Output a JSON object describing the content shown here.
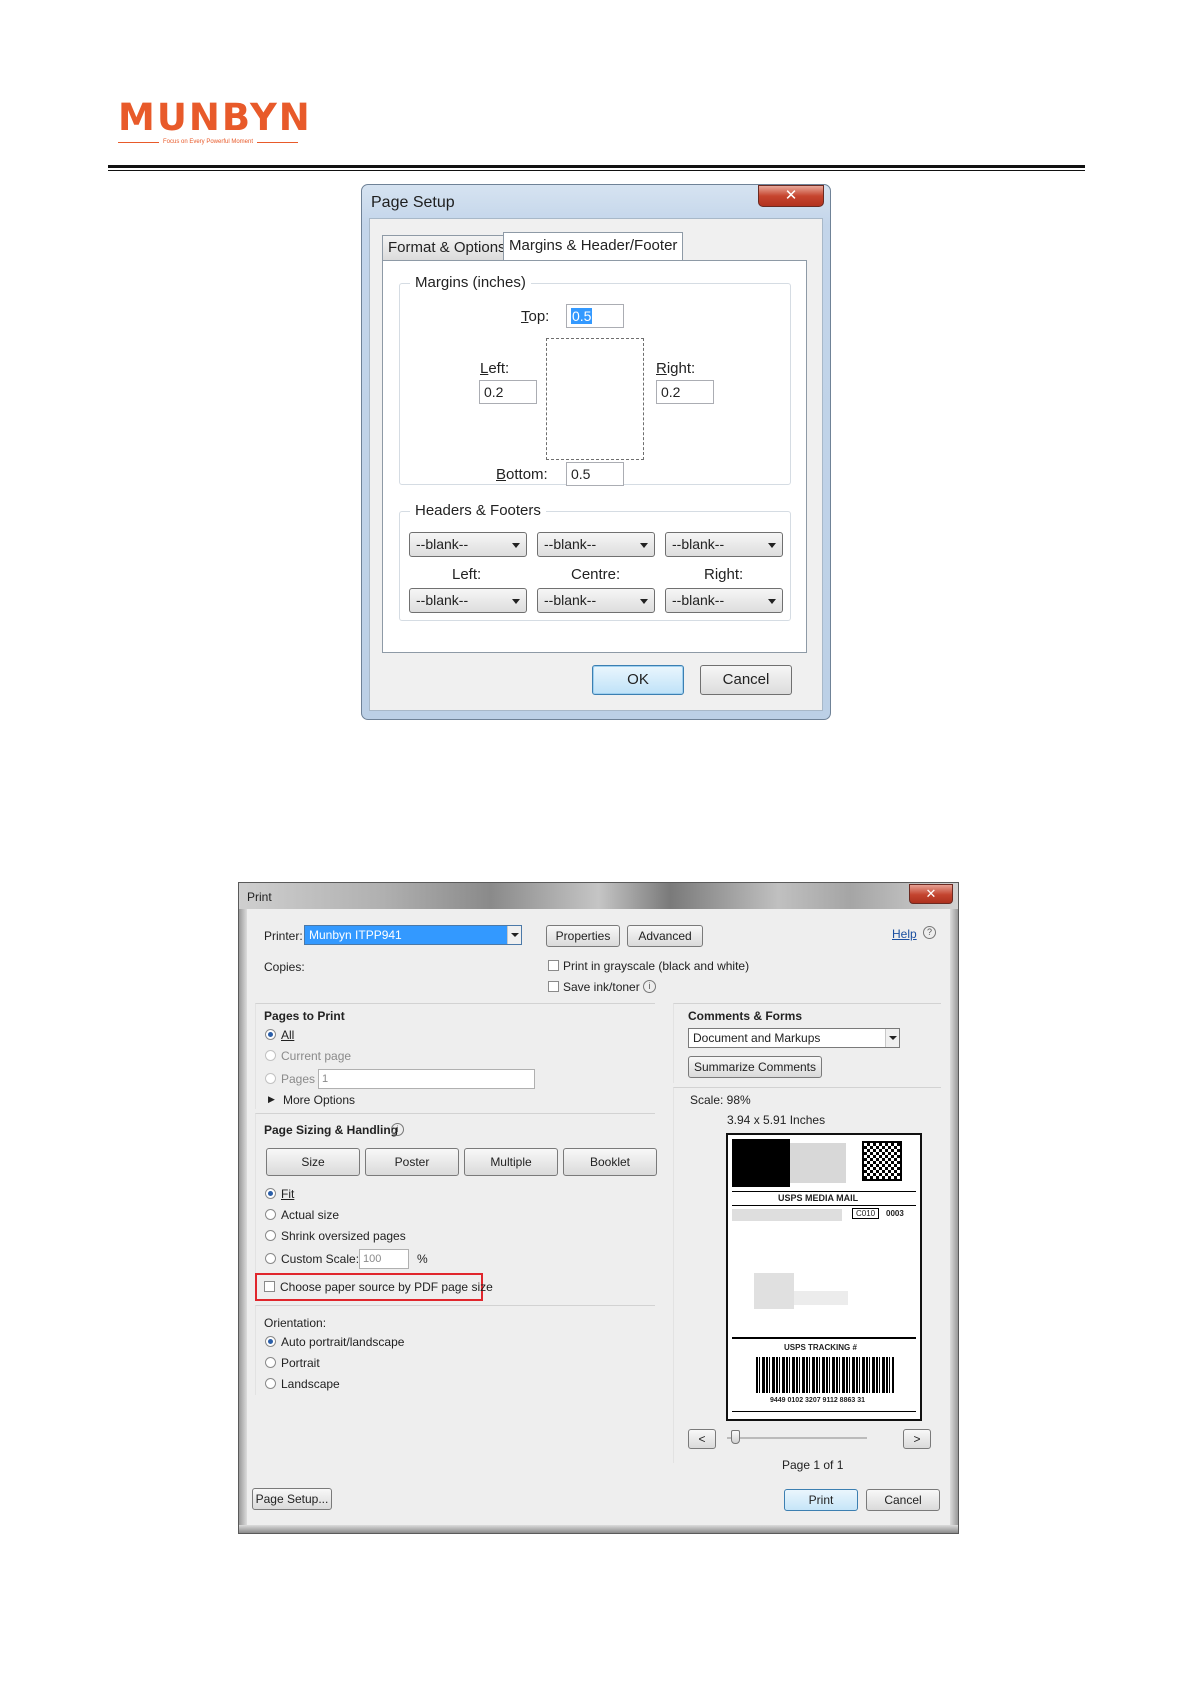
{
  "brand": {
    "name": "MUNBYN",
    "tagline": "Focus on Every Powerful Moment"
  },
  "page_setup": {
    "title": "Page Setup",
    "close_glyph": "✕",
    "tabs": [
      "Format & Options",
      "Margins & Header/Footer"
    ],
    "margins_group": "Margins (inches)",
    "labels": {
      "top": "Top:",
      "left": "Left:",
      "right": "Right:",
      "bottom": "Bottom:"
    },
    "values": {
      "top": "0.5",
      "left": "0.2",
      "right": "0.2",
      "bottom": "0.5"
    },
    "headers_group": "Headers & Footers",
    "column_labels": [
      "Left:",
      "Centre:",
      "Right:"
    ],
    "header_values": [
      "--blank--",
      "--blank--",
      "--blank--"
    ],
    "footer_values": [
      "--blank--",
      "--blank--",
      "--blank--"
    ],
    "ok": "OK",
    "cancel": "Cancel"
  },
  "print": {
    "title": "Print",
    "close_glyph": "✕",
    "printer_label": "Printer:",
    "printer_value": "Munbyn ITPP941",
    "properties": "Properties",
    "advanced": "Advanced",
    "help": "Help",
    "copies_label": "Copies:",
    "grayscale": "Print in grayscale (black and white)",
    "save_ink": "Save ink/toner",
    "pages_to_print": {
      "title": "Pages to Print",
      "all": "All",
      "current": "Current page",
      "pages": "Pages",
      "pages_value": "1",
      "more": "More Options"
    },
    "sizing": {
      "title": "Page Sizing & Handling",
      "buttons": [
        "Size",
        "Poster",
        "Multiple",
        "Booklet"
      ],
      "fit": "Fit",
      "actual": "Actual size",
      "shrink": "Shrink oversized pages",
      "custom": "Custom Scale:",
      "custom_value": "100",
      "percent": "%",
      "choose_paper": "Choose paper source by PDF page size"
    },
    "orientation": {
      "title": "Orientation:",
      "auto": "Auto portrait/landscape",
      "portrait": "Portrait",
      "landscape": "Landscape"
    },
    "comments": {
      "title": "Comments & Forms",
      "value": "Document and Markups",
      "summarize": "Summarize Comments"
    },
    "scale": "Scale: 98%",
    "dimensions": "3.94 x 5.91 Inches",
    "label_preview": {
      "service": "USPS MEDIA MAIL",
      "code": "C010",
      "number": "0003",
      "tracking": "USPS TRACKING #",
      "tracking_number": "9449 0102 3207 9112 8863 31"
    },
    "nav_prev": "<",
    "nav_next": ">",
    "page_indicator": "Page 1 of 1",
    "page_setup_button": "Page Setup...",
    "print_button": "Print",
    "cancel_button": "Cancel"
  }
}
